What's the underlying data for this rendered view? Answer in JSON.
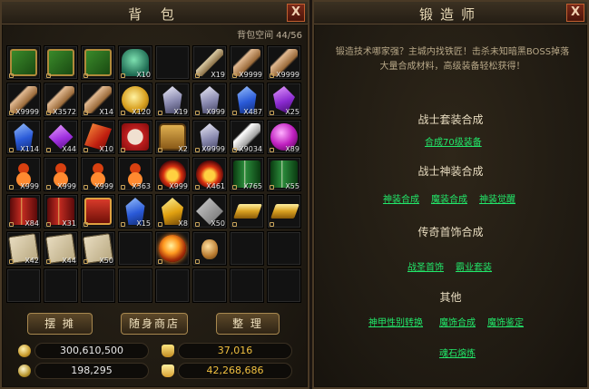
{
  "bag": {
    "title": "背 包",
    "close": "X",
    "capacity_label": "背包空间",
    "capacity_value": "44/56",
    "slots": [
      {
        "kind": "chest-green",
        "count": ""
      },
      {
        "kind": "chest-green",
        "count": ""
      },
      {
        "kind": "chest-green",
        "count": ""
      },
      {
        "kind": "jade-lion",
        "count": "X10"
      },
      {
        "kind": "empty",
        "count": ""
      },
      {
        "kind": "scroll",
        "count": "X19"
      },
      {
        "kind": "feather",
        "count": "X9999"
      },
      {
        "kind": "feather",
        "count": "X9999"
      },
      {
        "kind": "feather",
        "count": "X9999"
      },
      {
        "kind": "feather",
        "count": "X3572"
      },
      {
        "kind": "feather",
        "count": "X14"
      },
      {
        "kind": "gold-orb",
        "count": "X120"
      },
      {
        "kind": "crystal-white",
        "count": "X19"
      },
      {
        "kind": "crystal-white",
        "count": "X999"
      },
      {
        "kind": "crystal-blue",
        "count": "X487"
      },
      {
        "kind": "purple-shard",
        "count": "X25"
      },
      {
        "kind": "crystal-blue",
        "count": "X114"
      },
      {
        "kind": "purple-gem",
        "count": "X44"
      },
      {
        "kind": "red-card",
        "count": "X10"
      },
      {
        "kind": "red-seal",
        "count": ""
      },
      {
        "kind": "treasure-chest",
        "count": "X2"
      },
      {
        "kind": "crystal-white",
        "count": "X9999"
      },
      {
        "kind": "feather-white",
        "count": "X9034"
      },
      {
        "kind": "purple-orb",
        "count": "X89"
      },
      {
        "kind": "gourd",
        "count": "X999"
      },
      {
        "kind": "gourd",
        "count": "X999"
      },
      {
        "kind": "gourd",
        "count": "X999"
      },
      {
        "kind": "gourd",
        "count": "X363"
      },
      {
        "kind": "footprint",
        "count": "X999"
      },
      {
        "kind": "footprint",
        "count": "X461"
      },
      {
        "kind": "green-book",
        "count": "X765"
      },
      {
        "kind": "green-book",
        "count": "X55"
      },
      {
        "kind": "red-book",
        "count": "X84"
      },
      {
        "kind": "red-book",
        "count": "X31"
      },
      {
        "kind": "red-box",
        "count": ""
      },
      {
        "kind": "crystal-blue",
        "count": "X15"
      },
      {
        "kind": "gold-crystal",
        "count": "X8"
      },
      {
        "kind": "rune",
        "count": "X50"
      },
      {
        "kind": "gold-bar",
        "count": ""
      },
      {
        "kind": "gold-bar",
        "count": ""
      },
      {
        "kind": "map",
        "count": "X42"
      },
      {
        "kind": "map",
        "count": "X44"
      },
      {
        "kind": "map",
        "count": "X50"
      },
      {
        "kind": "empty",
        "count": ""
      },
      {
        "kind": "fire-orb",
        "count": ""
      },
      {
        "kind": "bean",
        "count": ""
      },
      {
        "kind": "empty",
        "count": ""
      },
      {
        "kind": "empty",
        "count": ""
      },
      {
        "kind": "empty",
        "count": ""
      },
      {
        "kind": "empty",
        "count": ""
      },
      {
        "kind": "empty",
        "count": ""
      },
      {
        "kind": "empty",
        "count": ""
      },
      {
        "kind": "empty",
        "count": ""
      },
      {
        "kind": "empty",
        "count": ""
      },
      {
        "kind": "empty",
        "count": ""
      },
      {
        "kind": "empty",
        "count": ""
      }
    ],
    "buttons": {
      "stall": "摆 摊",
      "shop": "随身商店",
      "sort": "整 理"
    },
    "currency": {
      "gold": "300,610,500",
      "ingot": "37,016",
      "coin": "198,295",
      "bound_ingot": "42,268,686"
    }
  },
  "forge": {
    "title": "锻造师",
    "close": "X",
    "message": "锻造技术哪家强？主城内找铁匠！击杀未知暗黑BOSS掉落大量合成材料，高级装备轻松获得！",
    "sections": [
      {
        "title": "战士套装合成",
        "links": [
          "合成70级装备"
        ]
      },
      {
        "title": "战士神装合成",
        "links": [
          "神装合成",
          "魔装合成",
          "神装觉醒"
        ]
      },
      {
        "title": "传奇首饰合成",
        "links": [
          "战圣首饰",
          "霸业套装"
        ]
      },
      {
        "title": "其他",
        "links": [
          "神甲性别转换",
          "魔饰合成",
          "魔饰鉴定",
          "魂石熔炼"
        ]
      }
    ]
  },
  "colors": {
    "link": "#22e86a",
    "gold_text": "#f0c040",
    "white_text": "#e8e8e8",
    "panel_border": "#4a3a26"
  }
}
